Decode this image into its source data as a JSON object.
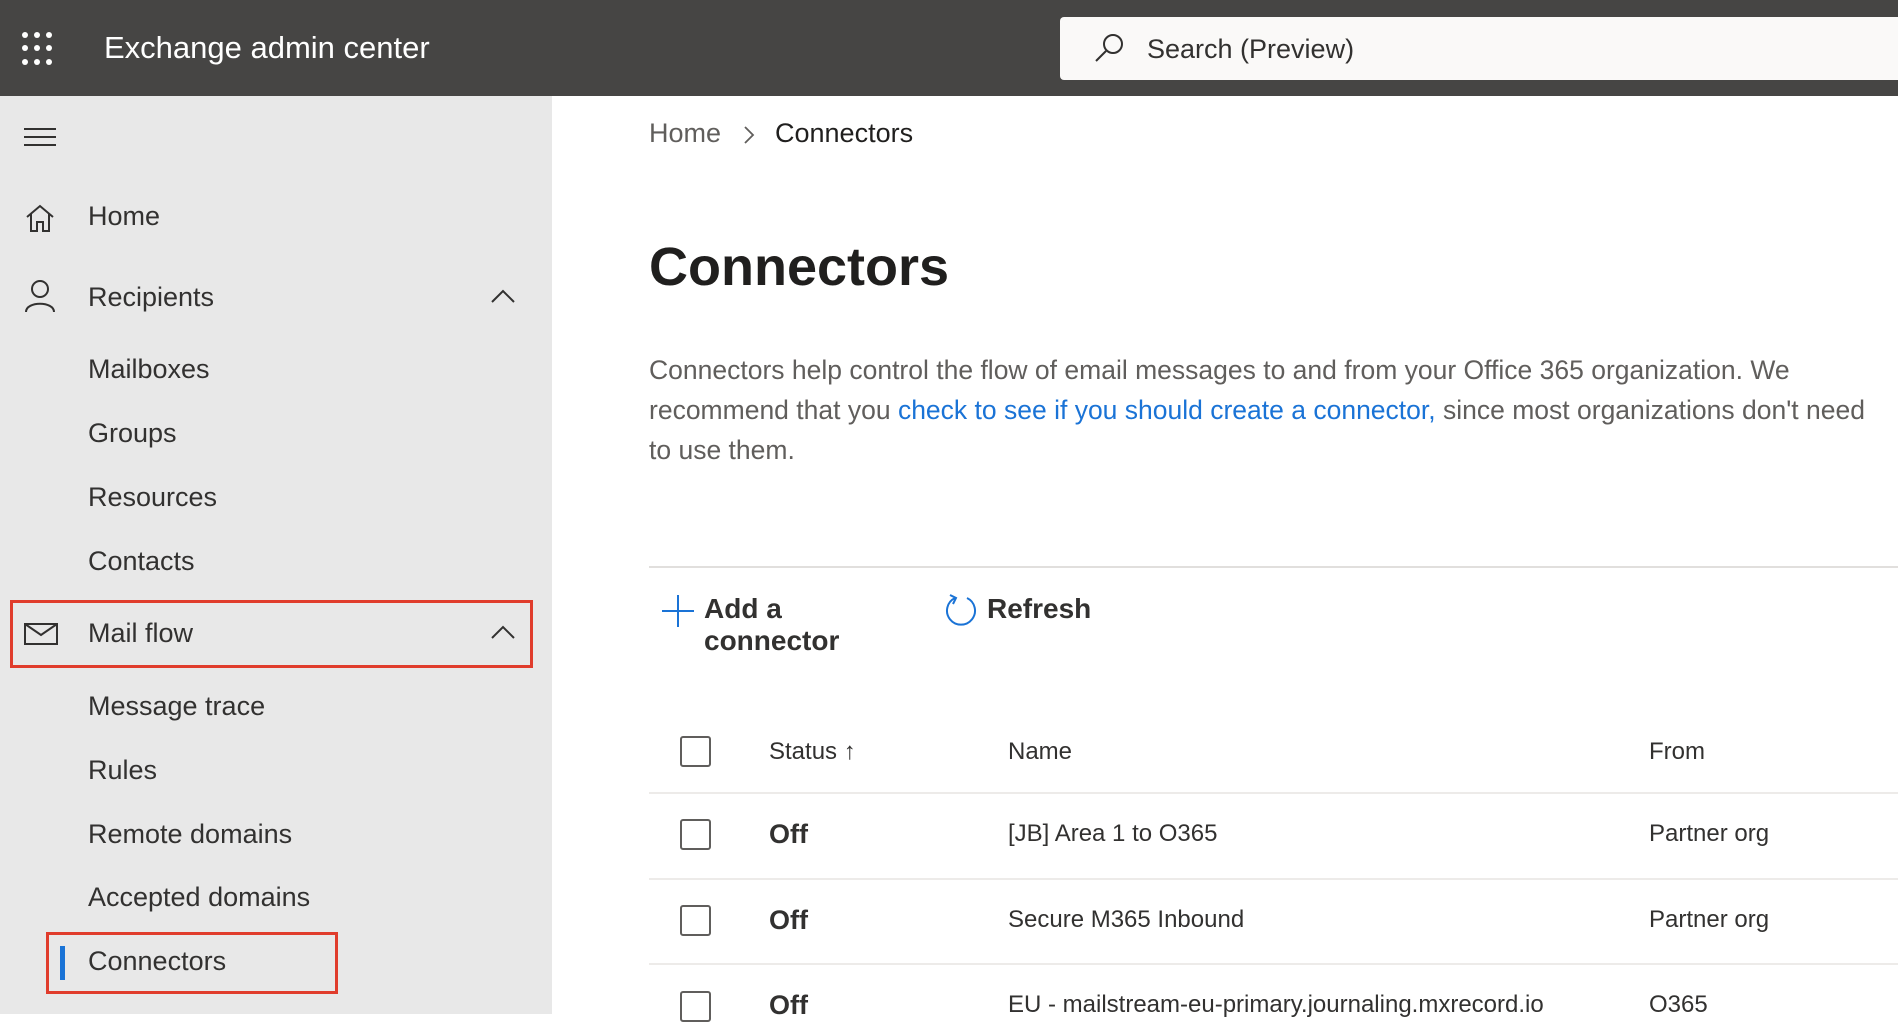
{
  "header": {
    "app_title": "Exchange admin center",
    "search_placeholder": "Search (Preview)"
  },
  "sidebar": {
    "items": [
      {
        "label": "Home",
        "icon": "home-icon"
      },
      {
        "label": "Recipients",
        "icon": "person-icon",
        "expanded": true
      },
      {
        "label": "Mailboxes"
      },
      {
        "label": "Groups"
      },
      {
        "label": "Resources"
      },
      {
        "label": "Contacts"
      },
      {
        "label": "Mail flow",
        "icon": "mail-icon",
        "expanded": true,
        "highlighted": true
      },
      {
        "label": "Message trace"
      },
      {
        "label": "Rules"
      },
      {
        "label": "Remote domains"
      },
      {
        "label": "Accepted domains"
      },
      {
        "label": "Connectors",
        "selected": true,
        "highlighted": true
      }
    ]
  },
  "breadcrumb": {
    "home": "Home",
    "current": "Connectors"
  },
  "page": {
    "title": "Connectors",
    "desc_before": "Connectors help control the flow of email messages to and from your Office 365 organization. We recommend that you ",
    "desc_link": "check to see if you should create a connector,",
    "desc_after": " since most organizations don't need to use them."
  },
  "toolbar": {
    "add": "Add a connector",
    "refresh": "Refresh"
  },
  "table": {
    "headers": {
      "status": "Status",
      "name": "Name",
      "from": "From"
    },
    "rows": [
      {
        "status": "Off",
        "name": "[JB] Area 1 to O365",
        "from": "Partner org"
      },
      {
        "status": "Off",
        "name": "Secure M365 Inbound",
        "from": "Partner org"
      },
      {
        "status": "Off",
        "name": "EU - mailstream-eu-primary.journaling.mxrecord.io",
        "from": "O365"
      }
    ]
  },
  "colors": {
    "accent": "#1a73d6",
    "highlight": "#e03c2c",
    "topbar": "#464544"
  }
}
